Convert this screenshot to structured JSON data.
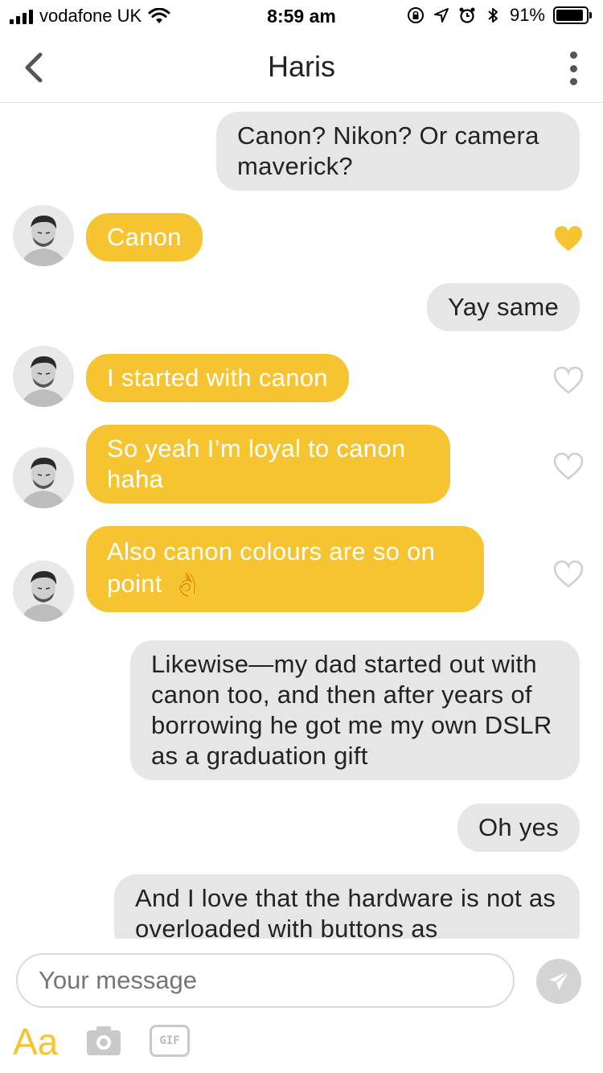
{
  "status_bar": {
    "carrier": "vodafone UK",
    "time": "8:59 am",
    "battery_percent": "91%",
    "battery_level": 0.91
  },
  "nav": {
    "title": "Haris",
    "back_icon": "chevron-left-icon",
    "more_icon": "more-vertical-icon"
  },
  "messages": [
    {
      "side": "out",
      "text": "Canon? Nikon? Or camera maverick?"
    },
    {
      "side": "in",
      "text": "Canon",
      "liked": true
    },
    {
      "side": "out",
      "text": "Yay same"
    },
    {
      "side": "in",
      "text": "I started with canon",
      "liked": false
    },
    {
      "side": "in",
      "text": "So yeah I’m loyal to canon haha",
      "liked": false
    },
    {
      "side": "in",
      "text": "Also canon colours are so on point",
      "emoji": "👌",
      "liked": false
    },
    {
      "side": "out",
      "text": "Likewise—my dad started out with canon too, and then after years of borrowing he got me my own DSLR as a graduation gift"
    },
    {
      "side": "out",
      "text": "Oh yes"
    },
    {
      "side": "out",
      "text": "And I love that the hardware is not as overloaded with buttons as"
    }
  ],
  "composer": {
    "placeholder": "Your message",
    "send_icon": "send-icon"
  },
  "toolbar": {
    "text_label": "Aa",
    "camera_icon": "camera-icon",
    "gif_label": "GIF"
  },
  "colors": {
    "accent": "#f7c431",
    "outgoing_bubble": "#e6e6e6",
    "divider": "#e2e2e2"
  }
}
